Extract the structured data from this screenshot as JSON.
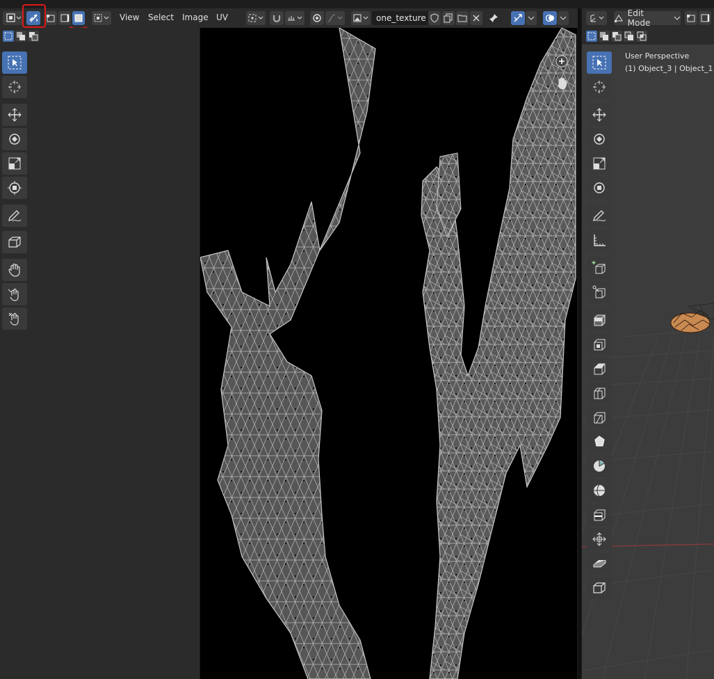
{
  "uv_header": {
    "menus": [
      "View",
      "Select",
      "Image",
      "UV"
    ],
    "image_name": "one_texture"
  },
  "viewport": {
    "mode": "Edit Mode",
    "perspective": "User Perspective",
    "object_info": "(1) Object_3 | Object_1"
  },
  "icons": {
    "sync_selection": "uv-sync-icon",
    "select_modes": [
      "vertex-select-icon",
      "edge-select-icon",
      "face-select-icon"
    ]
  },
  "colors": {
    "accent": "#4772b3",
    "annotation": "#e01818",
    "panel": "#2b2b2b",
    "mesh_fill": "#555555",
    "mesh_edge": "#b8b8b8"
  }
}
